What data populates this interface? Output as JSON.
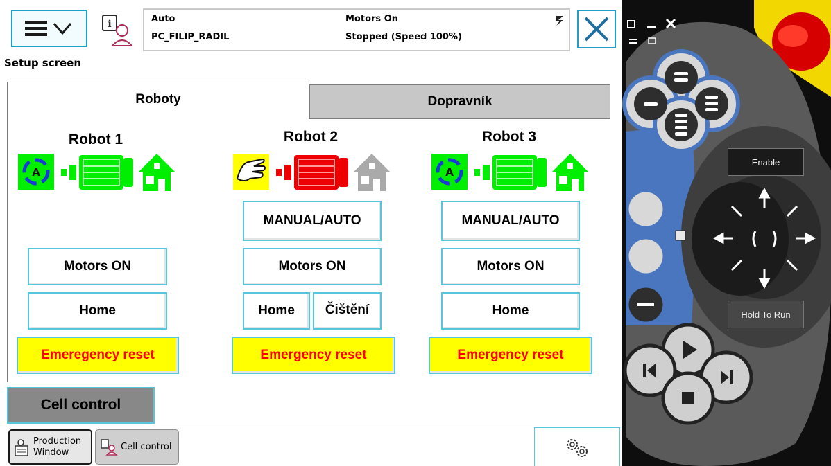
{
  "header": {
    "mode": "Auto",
    "controller_name": "PC_FILIP_RADIL",
    "motors_state": "Motors On",
    "run_state": "Stopped (Speed 100%)",
    "screen_title": "Setup screen"
  },
  "tabs": [
    {
      "label": "Roboty",
      "active": true
    },
    {
      "label": "Dopravník",
      "active": false
    }
  ],
  "robots": [
    {
      "title": "Robot 1",
      "mode_icon": "auto-mode-icon",
      "motor_status_color": "#00ee00",
      "home_status_color": "#00ee00",
      "motors_on_label": "Motors ON",
      "home_label": "Home",
      "emergency_label": "Emeregency reset"
    },
    {
      "title": "Robot 2",
      "mode_icon": "manual-hand-icon",
      "motor_status_color": "#ee0000",
      "home_status_color": "#aaaaaa",
      "manual_auto_label": "MANUAL/AUTO",
      "motors_on_label": "Motors ON",
      "home_label": "Home",
      "cleaning_label": "Čištění",
      "emergency_label": "Emergency reset"
    },
    {
      "title": "Robot 3",
      "mode_icon": "auto-mode-icon",
      "motor_status_color": "#00ee00",
      "home_status_color": "#00ee00",
      "manual_auto_label": "MANUAL/AUTO",
      "motors_on_label": "Motors ON",
      "home_label": "Home",
      "emergency_label": "Emergency reset"
    }
  ],
  "cell_control_label": "Cell control",
  "taskbar": {
    "production_window_line1": "Production",
    "production_window_line2": "Window",
    "cell_control_task": "Cell control"
  },
  "pendant": {
    "enable_label": "Enable",
    "hold_to_run_label": "Hold To Run"
  },
  "colors": {
    "accent": "#1e9fc9",
    "button_border": "#55c6dd",
    "emergency_bg": "#ffff00",
    "emergency_text": "#ff0000",
    "tab_inactive": "#c7c7c7",
    "cell_control_bg": "#888888"
  }
}
